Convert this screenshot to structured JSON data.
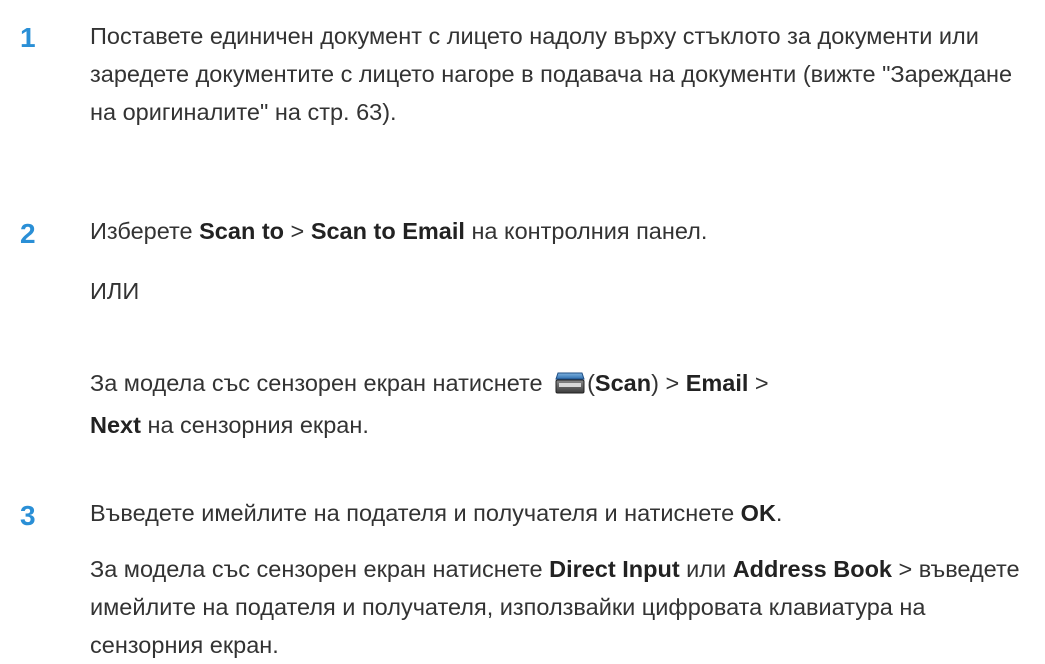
{
  "steps": [
    {
      "number": "1",
      "text": "Поставете единичен документ с лицето надолу върху стъклото за документи или заредете документите с лицето нагоре в подавача на документи (вижте \"Зареждане на оригиналите\" на стр. 63)."
    },
    {
      "number": "2",
      "line1": {
        "prefix": "Изберете ",
        "bold1": "Scan to",
        "sep": " > ",
        "bold2": "Scan to Email",
        "suffix": " на контролния панел."
      },
      "or_text": "ИЛИ",
      "line2": {
        "prefix": "За модела със сензорен екран натиснете ",
        "icon": "scanner-icon",
        "paren_open": "(",
        "bold_scan": "Scan",
        "paren_close": ") > ",
        "bold_email": "Email",
        "sep": " > ",
        "bold_next": "Next",
        "suffix": " на сензорния екран."
      }
    },
    {
      "number": "3",
      "line1": {
        "prefix": "Въведете имейлите на подателя и получателя и натиснете ",
        "bold_ok": "OK",
        "suffix": "."
      },
      "line2": {
        "prefix": "За модела със сензорен екран натиснете ",
        "bold_direct": "Direct Input",
        "mid": " или ",
        "bold_address": "Address Book",
        "suffix": " > въведете имейлите на подателя и получателя, използвайки цифровата клавиатура на сензорния екран."
      }
    }
  ],
  "colors": {
    "step_number": "#2a8fd6",
    "text": "#333333"
  }
}
